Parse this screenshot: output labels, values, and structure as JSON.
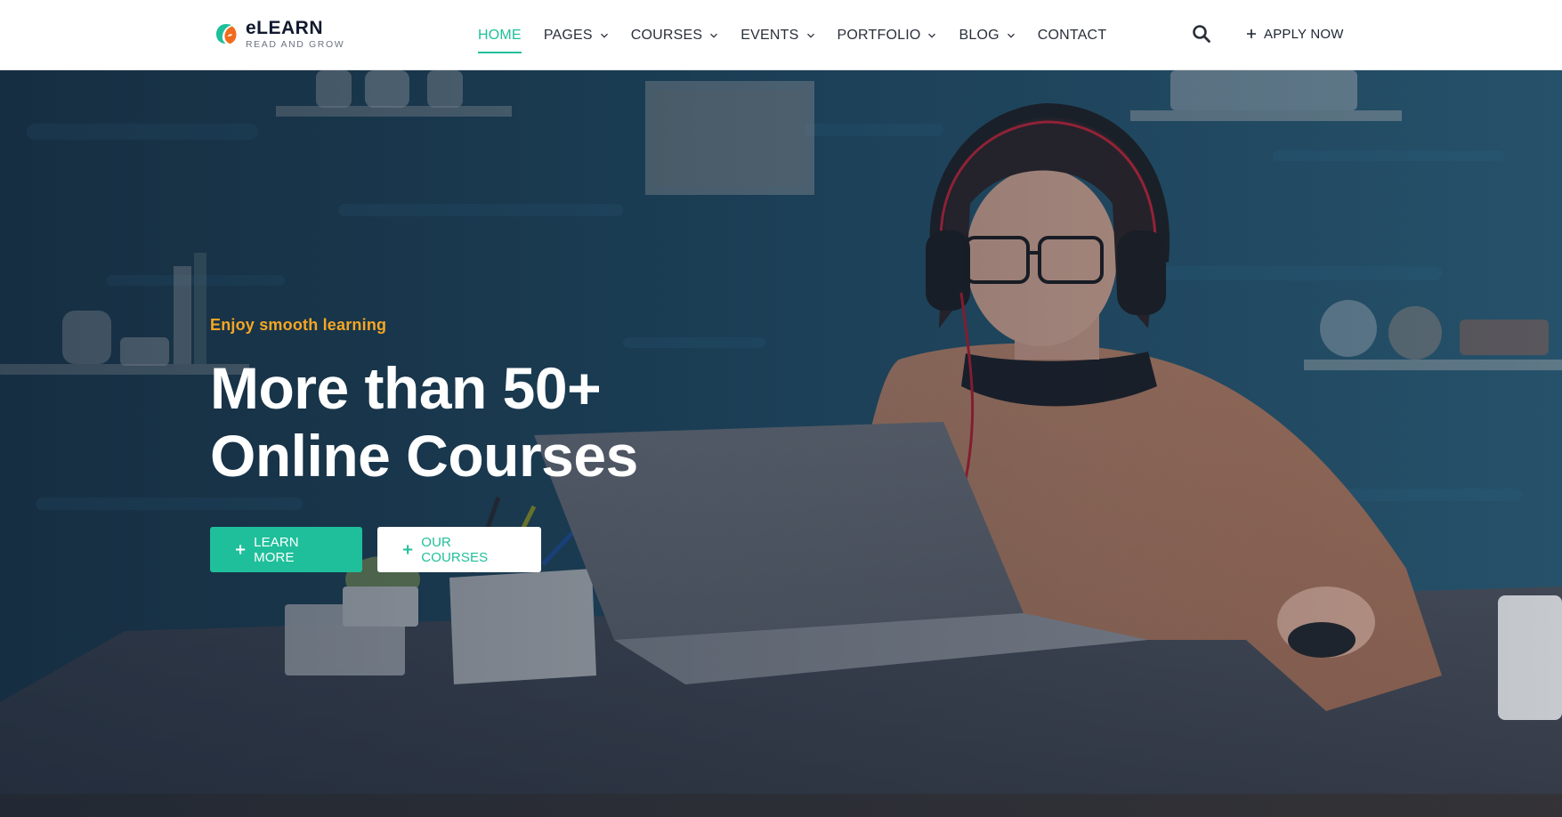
{
  "brand": {
    "title": "eLEARN",
    "subtitle": "READ AND GROW",
    "logo_icon": "leaf-e-icon",
    "colors": {
      "accent": "#1fbf9b",
      "logo_orange": "#f26b1d",
      "dark": "#111a2e"
    }
  },
  "nav": {
    "items": [
      {
        "label": "HOME",
        "active": true,
        "dropdown": false
      },
      {
        "label": "PAGES",
        "active": false,
        "dropdown": true
      },
      {
        "label": "COURSES",
        "active": false,
        "dropdown": true
      },
      {
        "label": "EVENTS",
        "active": false,
        "dropdown": true
      },
      {
        "label": "PORTFOLIO",
        "active": false,
        "dropdown": true
      },
      {
        "label": "BLOG",
        "active": false,
        "dropdown": true
      },
      {
        "label": "CONTACT",
        "active": false,
        "dropdown": false
      }
    ],
    "search_icon": "search-icon",
    "apply_label": "APPLY NOW"
  },
  "hero": {
    "tagline": "Enjoy smooth learning",
    "title_line1": "More than 50+",
    "title_line2": "Online Courses",
    "learn_more_label": "LEARN MORE",
    "our_courses_label": "OUR COURSES",
    "tagline_color": "#f5a623"
  }
}
